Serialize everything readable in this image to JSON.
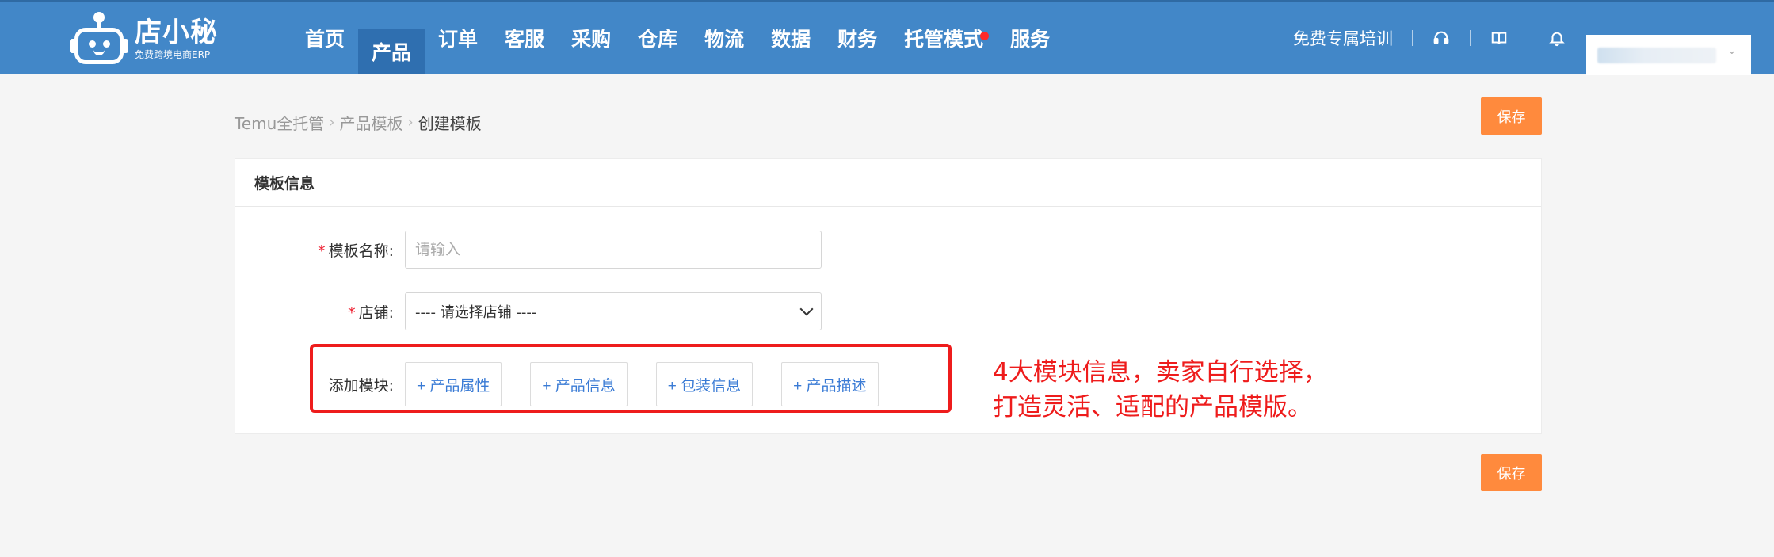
{
  "header": {
    "logo_name": "店小秘",
    "logo_sub": "免费跨境电商ERP",
    "nav": [
      {
        "label": "首页",
        "active": false
      },
      {
        "label": "产品",
        "active": true
      },
      {
        "label": "订单",
        "active": false
      },
      {
        "label": "客服",
        "active": false
      },
      {
        "label": "采购",
        "active": false
      },
      {
        "label": "仓库",
        "active": false
      },
      {
        "label": "物流",
        "active": false
      },
      {
        "label": "数据",
        "active": false
      },
      {
        "label": "财务",
        "active": false
      },
      {
        "label": "托管模式",
        "active": false,
        "badge_dot": true
      },
      {
        "label": "服务",
        "active": false
      }
    ],
    "training_link": "免费专属培训",
    "icons": [
      "headset-icon",
      "book-icon",
      "bell-icon"
    ],
    "colors": {
      "bar": "#4287c8",
      "active": "#2f6fb0",
      "dot": "#ff2a2a"
    }
  },
  "breadcrumb": {
    "items": [
      "Temu全托管",
      "产品模板",
      "创建模板"
    ]
  },
  "actions": {
    "save_label": "保存",
    "save_color": "#ff8a3d"
  },
  "card": {
    "title": "模板信息",
    "fields": {
      "template_name_label": "模板名称:",
      "template_name_placeholder": "请输入",
      "template_name_value": "",
      "shop_label": "店铺:",
      "shop_selected": "---- 请选择店铺 ----"
    },
    "modules": {
      "label": "添加模块:",
      "buttons": [
        "+ 产品属性",
        "+ 产品信息",
        "+ 包装信息",
        "+ 产品描述"
      ]
    }
  },
  "annotation": {
    "line1": "4大模块信息，卖家自行选择，",
    "line2": "打造灵活、适配的产品模版。",
    "color": "#ee1c1c"
  }
}
